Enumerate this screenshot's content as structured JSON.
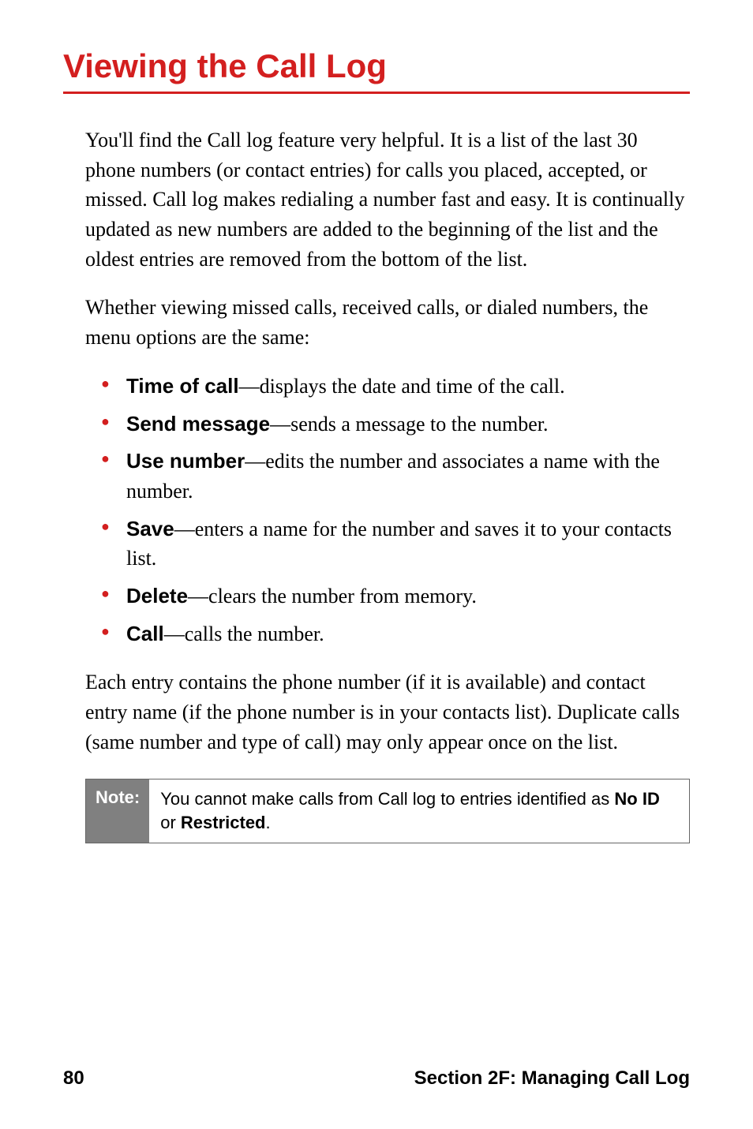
{
  "heading": "Viewing the Call Log",
  "intro_para": "You'll find the Call log feature very helpful. It is a list of the last 30 phone numbers (or contact entries) for calls you placed, accepted, or missed. Call log makes redialing a number fast and easy. It is continually updated as new numbers are added to the beginning of the list and the oldest entries are removed from the bottom of the list.",
  "second_para": "Whether viewing missed calls, received calls, or dialed numbers, the menu options are the same:",
  "options": [
    {
      "term": "Time of call",
      "desc": "—displays the date and time of the call."
    },
    {
      "term": "Send message",
      "desc": "—sends a message to the number."
    },
    {
      "term": "Use number",
      "desc": "—edits the number and associates a name with the number."
    },
    {
      "term": "Save",
      "desc": "—enters a name for the number and saves it to your contacts list."
    },
    {
      "term": "Delete",
      "desc": "—clears the number from memory."
    },
    {
      "term": "Call",
      "desc": "—calls the number."
    }
  ],
  "closing_para": "Each entry contains the phone number (if it is available) and contact entry name (if the phone number is in your contacts list). Duplicate calls (same number and type of call) may only appear once on the list.",
  "note": {
    "label": "Note:",
    "text_prefix": "You cannot make calls from Call log to entries identified as ",
    "bold1": "No ID",
    "mid": " or ",
    "bold2": "Restricted",
    "suffix": "."
  },
  "footer": {
    "page": "80",
    "section": "Section 2F: Managing Call Log"
  }
}
